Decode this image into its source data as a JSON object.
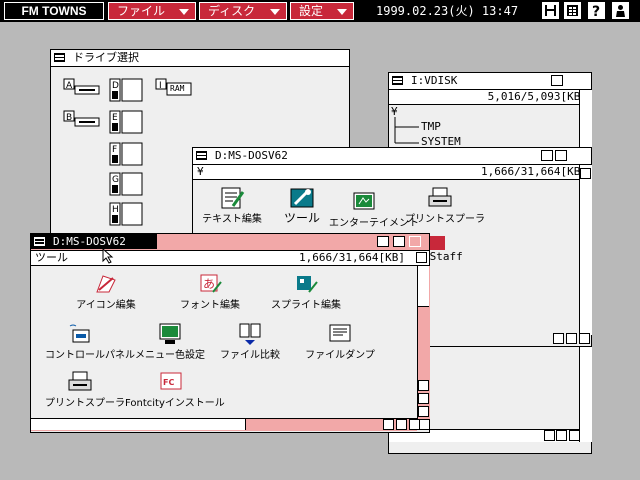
{
  "topbar": {
    "logo": "FM TOWNS",
    "menus": [
      "ファイル",
      "ディスク",
      "設定"
    ],
    "clock": "1999.02.23(火) 13:47",
    "icons": [
      "save-icon",
      "grid-icon",
      "help-icon",
      "user-icon"
    ]
  },
  "drive_window": {
    "title": "ドライブ選択",
    "drives": [
      "A",
      "B",
      "D",
      "E",
      "F",
      "G",
      "H",
      "I"
    ],
    "ram_label": "RAM"
  },
  "vdisk_window": {
    "title": "I:VDISK",
    "root": "¥",
    "usage": "5,016/5,093[KB]",
    "tree": [
      "TMP",
      "SYSTEM"
    ]
  },
  "msdos_back_window": {
    "title": "D:MS-DOSV62",
    "path": "¥",
    "usage": "1,666/31,664[KB]",
    "icons": [
      "テキスト編集",
      "ツール",
      "エンターテイメント",
      "プリントスプーラ"
    ],
    "partial_label": "sStaff"
  },
  "msdos_front_window": {
    "title": "D:MS-DOSV62",
    "path": "ツール",
    "usage": "1,666/31,664[KB]",
    "icons": [
      "アイコン編集",
      "フォント編集",
      "スプライト編集",
      "コントロールパネル",
      "メニュー色設定",
      "ファイル比較",
      "ファイルダンプ",
      "プリントスプーラ",
      "Fontcityインストール"
    ]
  },
  "colors": {
    "accent": "#c8283a",
    "window_bg": "#efefef",
    "desktop": "#b9b9b9",
    "active_pink": "#f2a8a8"
  }
}
